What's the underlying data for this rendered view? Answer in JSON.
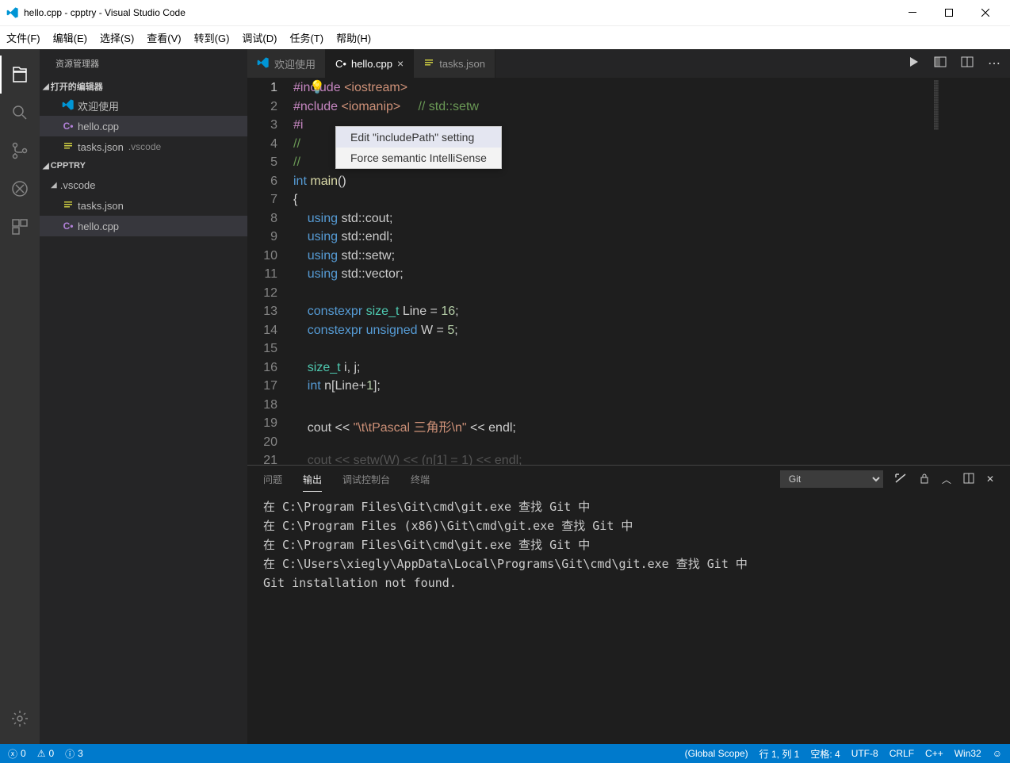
{
  "window": {
    "title": "hello.cpp - cpptry - Visual Studio Code"
  },
  "menu": [
    "文件(F)",
    "编辑(E)",
    "选择(S)",
    "查看(V)",
    "转到(G)",
    "调试(D)",
    "任务(T)",
    "帮助(H)"
  ],
  "sidebar": {
    "title": "资源管理器",
    "open_editors_label": "打开的编辑器",
    "open_editors": [
      {
        "label": "欢迎使用",
        "icon": "vscode"
      },
      {
        "label": "hello.cpp",
        "icon": "cpp",
        "active": true
      },
      {
        "label": "tasks.json",
        "icon": "json",
        "sub": ".vscode"
      }
    ],
    "project": "CPPTRY",
    "tree": [
      {
        "label": ".vscode",
        "type": "folder"
      },
      {
        "label": "tasks.json",
        "type": "json",
        "indent": true
      },
      {
        "label": "hello.cpp",
        "type": "cpp",
        "active": true
      }
    ]
  },
  "tabs": [
    {
      "label": "欢迎使用",
      "icon": "vscode"
    },
    {
      "label": "hello.cpp",
      "icon": "cpp",
      "active": true,
      "close": true
    },
    {
      "label": "tasks.json",
      "icon": "json"
    }
  ],
  "popup": {
    "items": [
      "Edit \"includePath\" setting",
      "Force semantic IntelliSense"
    ],
    "selected": 0
  },
  "code": {
    "lines": [
      {
        "n": 1,
        "html": "<span class='pp'>#include</span> <span class='str'>&lt;iostream&gt;</span>"
      },
      {
        "n": 2,
        "html": "<span class='pp'>#<span class='bulb'>💡</span>nclude</span> <span class='str'>&lt;iomanip&gt;</span>     <span class='cm'>// std::setw</span>"
      },
      {
        "n": 3,
        "html": "<span class='pp'>#i</span>"
      },
      {
        "n": 4,
        "html": "<span class='cm'>//</span>"
      },
      {
        "n": 5,
        "html": "<span class='cm'>//</span>"
      },
      {
        "n": 6,
        "html": "<span class='kw'>int</span> <span class='fn'>main</span><span class='op'>()</span>"
      },
      {
        "n": 7,
        "html": "<span class='op'>{</span>"
      },
      {
        "n": 8,
        "html": "    <span class='kw'>using</span> std::cout;"
      },
      {
        "n": 9,
        "html": "    <span class='kw'>using</span> std::endl;"
      },
      {
        "n": 10,
        "html": "    <span class='kw'>using</span> std::setw;"
      },
      {
        "n": 11,
        "html": "    <span class='kw'>using</span> std::vector;"
      },
      {
        "n": 12,
        "html": ""
      },
      {
        "n": 13,
        "html": "    <span class='kw'>constexpr</span> <span class='ty'>size_t</span> Line = <span class='num'>16</span>;"
      },
      {
        "n": 14,
        "html": "    <span class='kw'>constexpr</span> <span class='kw'>unsigned</span> W = <span class='num'>5</span>;"
      },
      {
        "n": 15,
        "html": ""
      },
      {
        "n": 16,
        "html": "    <span class='ty'>size_t</span> i, j;"
      },
      {
        "n": 17,
        "html": "    <span class='kw'>int</span> n[Line+<span class='num'>1</span>];"
      },
      {
        "n": 18,
        "html": ""
      },
      {
        "n": 19,
        "html": "    cout &lt;&lt; <span class='str'>\"\\t\\tPascal 三角形\\n\"</span> &lt;&lt; endl;"
      },
      {
        "n": 20,
        "html": ""
      },
      {
        "n": 21,
        "html": "    <span style='opacity:.3'>cout &lt;&lt; setw(W) &lt;&lt; (n[1] = 1) &lt;&lt; endl;</span>"
      }
    ]
  },
  "panel": {
    "tabs": [
      "问题",
      "输出",
      "调试控制台",
      "终端"
    ],
    "active": 1,
    "dropdown": "Git",
    "output": "在 C:\\Program Files\\Git\\cmd\\git.exe 查找 Git 中\n在 C:\\Program Files (x86)\\Git\\cmd\\git.exe 查找 Git 中\n在 C:\\Program Files\\Git\\cmd\\git.exe 查找 Git 中\n在 C:\\Users\\xiegly\\AppData\\Local\\Programs\\Git\\cmd\\git.exe 查找 Git 中\nGit installation not found."
  },
  "status": {
    "errors": "0",
    "warnings": "0",
    "info": "3",
    "scope": "(Global Scope)",
    "pos": "行 1, 列 1",
    "spaces": "空格: 4",
    "enc": "UTF-8",
    "eol": "CRLF",
    "lang": "C++",
    "plat": "Win32"
  }
}
